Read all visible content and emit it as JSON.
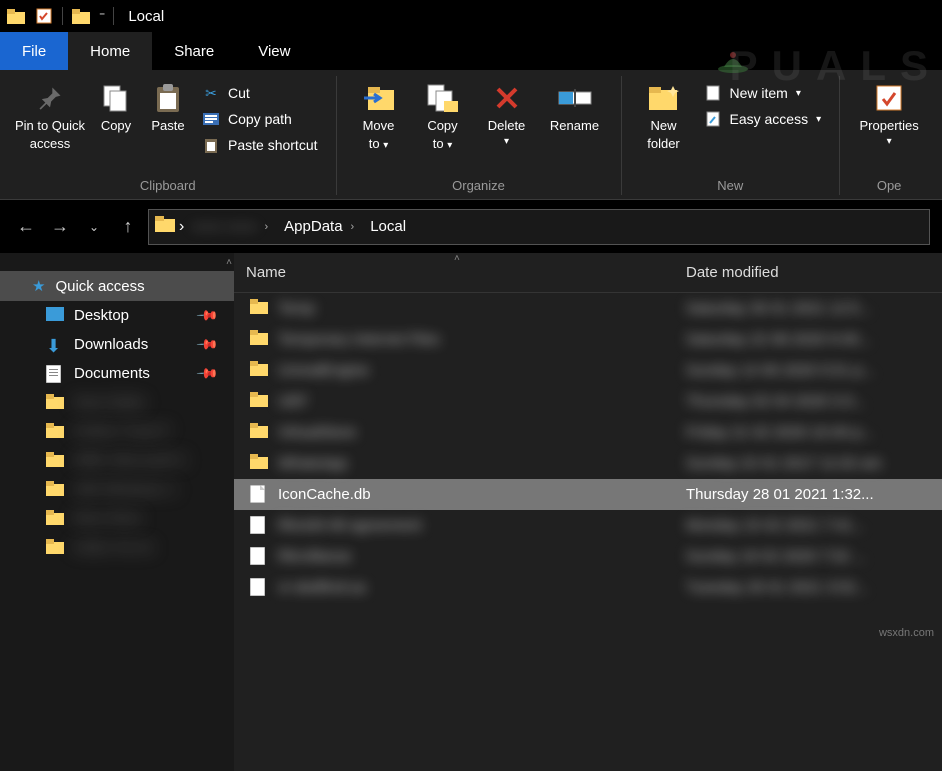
{
  "window": {
    "title": "Local"
  },
  "tabs": {
    "file": "File",
    "home": "Home",
    "share": "Share",
    "view": "View"
  },
  "ribbon": {
    "pin": {
      "line1": "Pin to Quick",
      "line2": "access"
    },
    "copy": "Copy",
    "paste": "Paste",
    "cut": "Cut",
    "copy_path": "Copy path",
    "paste_shortcut": "Paste shortcut",
    "move_to": {
      "line1": "Move",
      "line2": "to"
    },
    "copy_to": {
      "line1": "Copy",
      "line2": "to"
    },
    "delete": "Delete",
    "rename": "Rename",
    "new_folder": {
      "line1": "New",
      "line2": "folder"
    },
    "new_item": "New item",
    "easy_access": "Easy access",
    "properties": "Properties",
    "group_clipboard": "Clipboard",
    "group_organize": "Organize",
    "group_new": "New",
    "group_open": "Ope"
  },
  "breadcrumb": {
    "seg1": "—— ——",
    "seg2": "AppData",
    "seg3": "Local"
  },
  "sidebar": {
    "quick_access": "Quick access",
    "desktop": "Desktop",
    "downloads": "Downloads",
    "documents": "Documents"
  },
  "columns": {
    "name": "Name",
    "date_modified": "Date modified"
  },
  "rows": {
    "selected_name": "IconCache.db",
    "selected_date": "Thursday 28 01 2021 1:32..."
  },
  "blurred_names": [
    "Temp",
    "Temporary Internet Files",
    "UnrealEngine",
    "UEF",
    "VirtualStore",
    "WhatsApp",
    "RkvId4:48 agreement",
    "Rkrvillanse",
    "vr-dedfind:ua"
  ],
  "blurred_dates": [
    "Saturday 30 01 2021 12:5...",
    "Saturday 22 08 2020 9:40...",
    "Sunday 14 06 2020 5:51 p...",
    "Thursday 02 04 2020 3:3...",
    "Friday 21 02 2020 10:40 p...",
    "Sunday 22 01 2017 11:02 am",
    "Monday 15 02 2021 7:41...",
    "Sunday 16 02 2020 7:52 ...",
    "Tuesday 26 01 2021 3:52..."
  ],
  "sidebar_blurred": [
    "New folder",
    "Online Treat P",
    "3RB: Microsoft C",
    "185 Windows 1",
    "Rem Rem",
    "Index Int-on"
  ],
  "footer": "wsxdn.com"
}
